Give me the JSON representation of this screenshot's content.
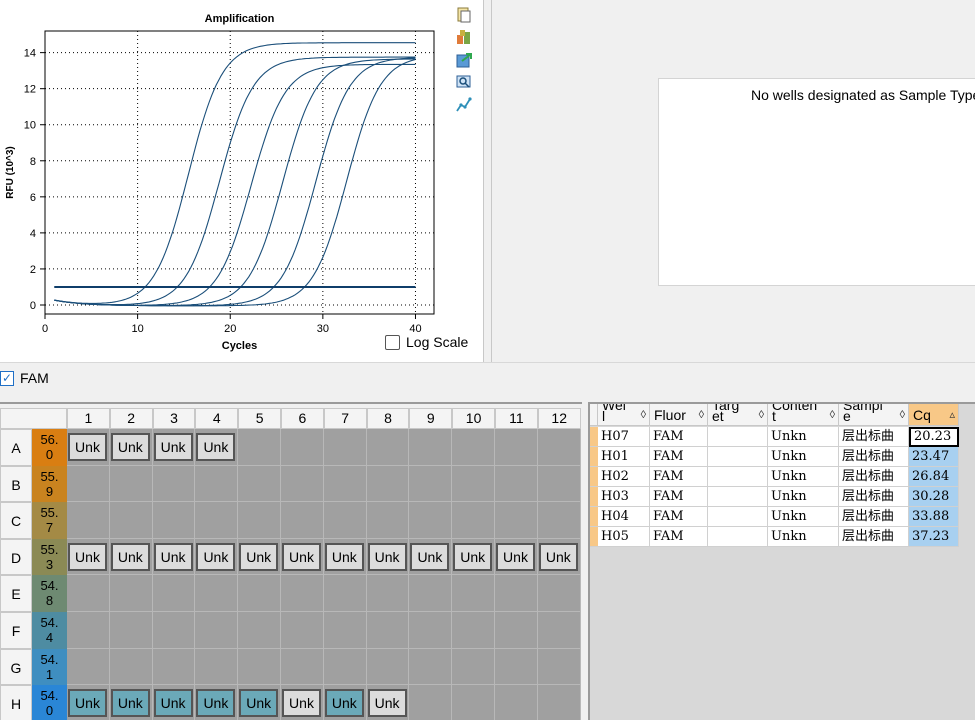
{
  "chart_data": {
    "type": "line",
    "title": "Amplification",
    "xlabel": "Cycles",
    "ylabel": "RFU (10^3)",
    "xlim": [
      0,
      42
    ],
    "ylim": [
      -0.5,
      15.2
    ],
    "xticks": [
      "0",
      "10",
      "20",
      "30",
      "40"
    ],
    "yticks": [
      "0",
      "2",
      "4",
      "6",
      "8",
      "10",
      "12",
      "14"
    ],
    "threshold": 1.0,
    "grid": true,
    "series_color": "#1b4f7a",
    "curves": [
      {
        "well": "H07",
        "cq": 20.23,
        "plateau": 14.6
      },
      {
        "well": "H01",
        "cq": 23.47,
        "plateau": 13.8
      },
      {
        "well": "H02",
        "cq": 26.84,
        "plateau": 13.4
      },
      {
        "well": "H03",
        "cq": 30.28,
        "plateau": 13.7
      },
      {
        "well": "H04",
        "cq": 33.88,
        "plateau": 13.8
      },
      {
        "well": "H05",
        "cq": 37.23,
        "plateau": 13.9
      }
    ]
  },
  "log_scale_label": "Log Scale",
  "no_wells_text": "No wells designated as Sample Type",
  "fluor_filter": {
    "label": "FAM",
    "checked": true
  },
  "plate": {
    "columns": [
      "1",
      "2",
      "3",
      "4",
      "5",
      "6",
      "7",
      "8",
      "9",
      "10",
      "11",
      "12"
    ],
    "rows": [
      {
        "label": "A",
        "temp": "56.\n0",
        "temp_color": "#d97e12",
        "wells": [
          "Unk",
          "Unk",
          "Unk",
          "Unk",
          "",
          "",
          "",
          "",
          "",
          "",
          "",
          ""
        ]
      },
      {
        "label": "B",
        "temp": "55.\n9",
        "temp_color": "#c9831f",
        "wells": [
          "",
          "",
          "",
          "",
          "",
          "",
          "",
          "",
          "",
          "",
          "",
          ""
        ]
      },
      {
        "label": "C",
        "temp": "55.\n7",
        "temp_color": "#a48a45",
        "wells": [
          "",
          "",
          "",
          "",
          "",
          "",
          "",
          "",
          "",
          "",
          "",
          ""
        ]
      },
      {
        "label": "D",
        "temp": "55.\n3",
        "temp_color": "#8b8a55",
        "wells": [
          "Unk",
          "Unk",
          "Unk",
          "Unk",
          "Unk",
          "Unk",
          "Unk",
          "Unk",
          "Unk",
          "Unk",
          "Unk",
          "Unk"
        ]
      },
      {
        "label": "E",
        "temp": "54.\n8",
        "temp_color": "#6e8a72",
        "wells": [
          "",
          "",
          "",
          "",
          "",
          "",
          "",
          "",
          "",
          "",
          "",
          ""
        ]
      },
      {
        "label": "F",
        "temp": "54.\n4",
        "temp_color": "#4e8ca2",
        "wells": [
          "",
          "",
          "",
          "",
          "",
          "",
          "",
          "",
          "",
          "",
          "",
          ""
        ]
      },
      {
        "label": "G",
        "temp": "54.\n1",
        "temp_color": "#3f8ec0",
        "wells": [
          "",
          "",
          "",
          "",
          "",
          "",
          "",
          "",
          "",
          "",
          "",
          ""
        ]
      },
      {
        "label": "H",
        "temp": "54.\n0",
        "temp_color": "#2a86d6",
        "wells": [
          "Unk",
          "Unk",
          "Unk",
          "Unk",
          "Unk",
          "Unk",
          "Unk",
          "Unk",
          "",
          "",
          "",
          ""
        ],
        "selected": [
          true,
          true,
          true,
          true,
          true,
          false,
          true,
          false
        ]
      }
    ]
  },
  "results_table": {
    "columns": [
      "Wel\nl",
      "Fluor",
      "Targ\net",
      "Conten\nt",
      "Sampl\ne",
      "Cq"
    ],
    "rows": [
      [
        "H07",
        "FAM",
        "",
        "Unkn",
        "层出标曲",
        "20.23"
      ],
      [
        "H01",
        "FAM",
        "",
        "Unkn",
        "层出标曲",
        "23.47"
      ],
      [
        "H02",
        "FAM",
        "",
        "Unkn",
        "层出标曲",
        "26.84"
      ],
      [
        "H03",
        "FAM",
        "",
        "Unkn",
        "层出标曲",
        "30.28"
      ],
      [
        "H04",
        "FAM",
        "",
        "Unkn",
        "层出标曲",
        "33.88"
      ],
      [
        "H05",
        "FAM",
        "",
        "Unkn",
        "层出标曲",
        "37.23"
      ]
    ]
  },
  "toolbar_icons": [
    "copy-icon",
    "export-icon",
    "refresh-icon",
    "zoom-icon",
    "curve-settings-icon"
  ]
}
